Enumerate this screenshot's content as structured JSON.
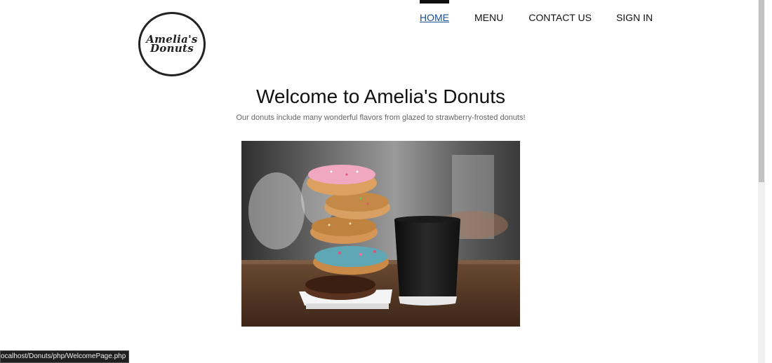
{
  "logo": {
    "line1": "Amelia's",
    "line2": "Donuts"
  },
  "nav": {
    "items": [
      {
        "label": "HOME",
        "active": true
      },
      {
        "label": "MENU",
        "active": false
      },
      {
        "label": "CONTACT US",
        "active": false
      },
      {
        "label": "SIGN IN",
        "active": false
      }
    ]
  },
  "main": {
    "title": "Welcome to Amelia's Donuts",
    "subtitle": "Our donuts include many wonderful flavors from glazed to strawberry-frosted donuts!"
  },
  "status": {
    "url": "ocalhost/Donuts/php/WelcomePage.php"
  },
  "colors": {
    "active_nav": "#1a4f8a",
    "text": "#111111"
  }
}
